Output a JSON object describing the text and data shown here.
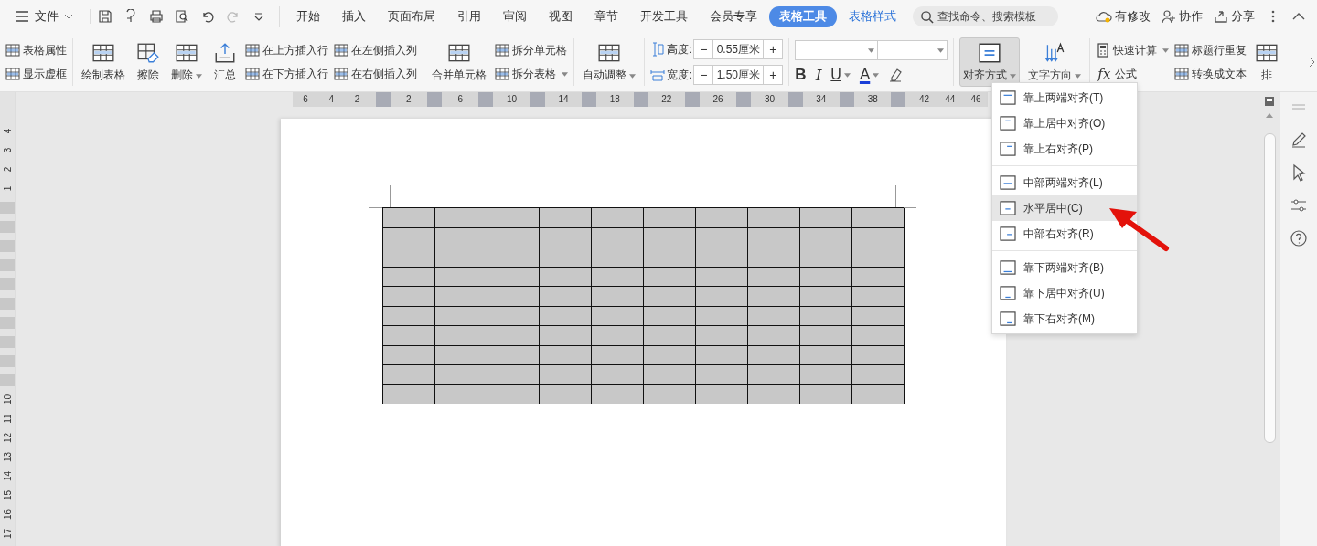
{
  "menu": {
    "label": "文件"
  },
  "tabs": [
    {
      "label": "开始",
      "selected": false,
      "kind": "normal"
    },
    {
      "label": "插入",
      "selected": false,
      "kind": "normal"
    },
    {
      "label": "页面布局",
      "selected": false,
      "kind": "normal"
    },
    {
      "label": "引用",
      "selected": false,
      "kind": "normal"
    },
    {
      "label": "审阅",
      "selected": false,
      "kind": "normal"
    },
    {
      "label": "视图",
      "selected": false,
      "kind": "normal"
    },
    {
      "label": "章节",
      "selected": false,
      "kind": "normal"
    },
    {
      "label": "开发工具",
      "selected": false,
      "kind": "normal"
    },
    {
      "label": "会员专享",
      "selected": false,
      "kind": "normal"
    },
    {
      "label": "表格工具",
      "selected": true,
      "kind": "contextual"
    },
    {
      "label": "表格样式",
      "selected": false,
      "kind": "contextual"
    }
  ],
  "search": {
    "placeholder": "查找命令、搜索模板"
  },
  "header_actions": [
    {
      "label": "有修改"
    },
    {
      "label": "协作"
    },
    {
      "label": "分享"
    }
  ],
  "ribbon": [
    {
      "columns": [
        {
          "kind": "pair",
          "items": [
            {
              "label": "表格属性",
              "dropdown": false,
              "pressed": false
            },
            {
              "label": "显示虚框",
              "dropdown": false,
              "pressed": false
            }
          ]
        }
      ]
    },
    {
      "columns": [
        {
          "kind": "large",
          "items": [
            {
              "label": "绘制表格",
              "dropdown": false,
              "pressed": false
            }
          ]
        },
        {
          "kind": "large",
          "items": [
            {
              "label": "擦除",
              "dropdown": false,
              "pressed": false
            }
          ]
        },
        {
          "kind": "large",
          "items": [
            {
              "label": "删除",
              "dropdown": true,
              "pressed": false
            }
          ]
        },
        {
          "kind": "large",
          "items": [
            {
              "label": "汇总",
              "dropdown": false,
              "pressed": false
            }
          ]
        },
        {
          "kind": "pair",
          "items": [
            {
              "label": "在上方插入行",
              "dropdown": false,
              "pressed": false
            },
            {
              "label": "在下方插入行",
              "dropdown": false,
              "pressed": false
            }
          ]
        },
        {
          "kind": "pair",
          "items": [
            {
              "label": "在左侧插入列",
              "dropdown": false,
              "pressed": false
            },
            {
              "label": "在右侧插入列",
              "dropdown": false,
              "pressed": false
            }
          ]
        }
      ]
    },
    {
      "columns": [
        {
          "kind": "large",
          "items": [
            {
              "label": "合并单元格",
              "dropdown": false,
              "pressed": false
            }
          ]
        },
        {
          "kind": "pair",
          "items": [
            {
              "label": "拆分单元格",
              "dropdown": false,
              "pressed": false
            },
            {
              "label": "拆分表格",
              "dropdown": true,
              "pressed": false
            }
          ]
        }
      ]
    },
    {
      "columns": [
        {
          "kind": "large",
          "items": [
            {
              "label": "自动调整",
              "dropdown": true,
              "pressed": false
            }
          ]
        }
      ]
    },
    {
      "columns": [
        {
          "kind": "stepper",
          "items": [
            {
              "label": "高度:",
              "value": "0.55厘米",
              "minus": "−",
              "plus": "+"
            },
            {
              "label": "宽度:",
              "value": "1.50厘米",
              "minus": "−",
              "plus": "+"
            }
          ]
        }
      ]
    },
    {
      "columns": [
        {
          "kind": "font",
          "items": [
            {
              "label": "B",
              "dropdown": false
            },
            {
              "label": "I",
              "dropdown": false
            },
            {
              "label": "U",
              "dropdown": true
            },
            {
              "label": "A",
              "dropdown": true
            }
          ]
        }
      ]
    },
    {
      "columns": [
        {
          "kind": "large",
          "items": [
            {
              "label": "对齐方式",
              "dropdown": true,
              "pressed": true
            }
          ]
        },
        {
          "kind": "large",
          "items": [
            {
              "label": "文字方向",
              "dropdown": true,
              "pressed": false
            }
          ]
        }
      ]
    },
    {
      "columns": [
        {
          "kind": "pair",
          "items": [
            {
              "label": "快速计算",
              "dropdown": true,
              "pressed": false
            },
            {
              "label": "公式",
              "symbol": "fx",
              "dropdown": false,
              "pressed": false
            }
          ]
        },
        {
          "kind": "pair",
          "items": [
            {
              "label": "标题行重复",
              "dropdown": false,
              "pressed": false
            },
            {
              "label": "转换成文本",
              "dropdown": false,
              "pressed": false
            }
          ]
        },
        {
          "kind": "large",
          "items": [
            {
              "label": "排",
              "dropdown": false,
              "pressed": false
            }
          ]
        }
      ]
    }
  ],
  "ruler": [
    {
      "kind": "number",
      "label": "6"
    },
    {
      "kind": "number",
      "label": "4"
    },
    {
      "kind": "number",
      "label": "2"
    },
    {
      "kind": "marker"
    },
    {
      "kind": "number",
      "label": "2"
    },
    {
      "kind": "marker"
    },
    {
      "kind": "number",
      "label": "6"
    },
    {
      "kind": "marker"
    },
    {
      "kind": "number",
      "label": "10"
    },
    {
      "kind": "marker"
    },
    {
      "kind": "number",
      "label": "14"
    },
    {
      "kind": "marker"
    },
    {
      "kind": "number",
      "label": "18"
    },
    {
      "kind": "marker"
    },
    {
      "kind": "number",
      "label": "22"
    },
    {
      "kind": "marker"
    },
    {
      "kind": "number",
      "label": "26"
    },
    {
      "kind": "marker"
    },
    {
      "kind": "number",
      "label": "30"
    },
    {
      "kind": "marker"
    },
    {
      "kind": "number",
      "label": "34"
    },
    {
      "kind": "marker"
    },
    {
      "kind": "number",
      "label": "38"
    },
    {
      "kind": "marker"
    },
    {
      "kind": "number",
      "label": "42"
    },
    {
      "kind": "number",
      "label": "44"
    },
    {
      "kind": "number",
      "label": "46"
    }
  ],
  "vruler": [
    {
      "kind": "number",
      "label": "4"
    },
    {
      "kind": "number",
      "label": "3"
    },
    {
      "kind": "number",
      "label": "2"
    },
    {
      "kind": "number",
      "label": "1"
    },
    {
      "kind": "marker"
    },
    {
      "kind": "marker"
    },
    {
      "kind": "marker"
    },
    {
      "kind": "marker"
    },
    {
      "kind": "marker"
    },
    {
      "kind": "marker"
    },
    {
      "kind": "marker"
    },
    {
      "kind": "marker"
    },
    {
      "kind": "marker"
    },
    {
      "kind": "marker"
    },
    {
      "kind": "number",
      "label": "10"
    },
    {
      "kind": "number",
      "label": "11"
    },
    {
      "kind": "number",
      "label": "12"
    },
    {
      "kind": "number",
      "label": "13"
    },
    {
      "kind": "number",
      "label": "14"
    },
    {
      "kind": "number",
      "label": "15"
    },
    {
      "kind": "number",
      "label": "16"
    },
    {
      "kind": "number",
      "label": "17"
    }
  ],
  "table": {
    "rows": [
      {
        "cells": [
          {
            "selected": true
          },
          {
            "selected": true
          },
          {
            "selected": true
          },
          {
            "selected": true
          },
          {
            "selected": true
          },
          {
            "selected": true
          },
          {
            "selected": true
          },
          {
            "selected": true
          },
          {
            "selected": true
          },
          {
            "selected": true
          }
        ]
      },
      {
        "cells": [
          {
            "selected": true
          },
          {
            "selected": true
          },
          {
            "selected": true
          },
          {
            "selected": true
          },
          {
            "selected": true
          },
          {
            "selected": true
          },
          {
            "selected": true
          },
          {
            "selected": true
          },
          {
            "selected": true
          },
          {
            "selected": true
          }
        ]
      },
      {
        "cells": [
          {
            "selected": true
          },
          {
            "selected": true
          },
          {
            "selected": true
          },
          {
            "selected": true
          },
          {
            "selected": true
          },
          {
            "selected": true
          },
          {
            "selected": true
          },
          {
            "selected": true
          },
          {
            "selected": true
          },
          {
            "selected": true
          }
        ]
      },
      {
        "cells": [
          {
            "selected": true
          },
          {
            "selected": true
          },
          {
            "selected": true
          },
          {
            "selected": true
          },
          {
            "selected": true
          },
          {
            "selected": true
          },
          {
            "selected": true
          },
          {
            "selected": true
          },
          {
            "selected": true
          },
          {
            "selected": true
          }
        ]
      },
      {
        "cells": [
          {
            "selected": true
          },
          {
            "selected": true
          },
          {
            "selected": true
          },
          {
            "selected": true
          },
          {
            "selected": true
          },
          {
            "selected": true
          },
          {
            "selected": true
          },
          {
            "selected": true
          },
          {
            "selected": true
          },
          {
            "selected": true
          }
        ]
      },
      {
        "cells": [
          {
            "selected": true
          },
          {
            "selected": true
          },
          {
            "selected": true
          },
          {
            "selected": true
          },
          {
            "selected": true
          },
          {
            "selected": true
          },
          {
            "selected": true
          },
          {
            "selected": true
          },
          {
            "selected": true
          },
          {
            "selected": true
          }
        ]
      },
      {
        "cells": [
          {
            "selected": true
          },
          {
            "selected": true
          },
          {
            "selected": true
          },
          {
            "selected": true
          },
          {
            "selected": true
          },
          {
            "selected": true
          },
          {
            "selected": true
          },
          {
            "selected": true
          },
          {
            "selected": true
          },
          {
            "selected": true
          }
        ]
      },
      {
        "cells": [
          {
            "selected": true
          },
          {
            "selected": true
          },
          {
            "selected": true
          },
          {
            "selected": true
          },
          {
            "selected": true
          },
          {
            "selected": true
          },
          {
            "selected": true
          },
          {
            "selected": true
          },
          {
            "selected": true
          },
          {
            "selected": true
          }
        ]
      },
      {
        "cells": [
          {
            "selected": true
          },
          {
            "selected": true
          },
          {
            "selected": true
          },
          {
            "selected": true
          },
          {
            "selected": true
          },
          {
            "selected": true
          },
          {
            "selected": true
          },
          {
            "selected": true
          },
          {
            "selected": true
          },
          {
            "selected": true
          }
        ]
      },
      {
        "cells": [
          {
            "selected": true
          },
          {
            "selected": true
          },
          {
            "selected": true
          },
          {
            "selected": true
          },
          {
            "selected": true
          },
          {
            "selected": true
          },
          {
            "selected": true
          },
          {
            "selected": true
          },
          {
            "selected": true
          },
          {
            "selected": true
          }
        ]
      }
    ]
  },
  "align_menu": {
    "groups": [
      [
        {
          "label": "靠上两端对齐(T)",
          "selected": false
        },
        {
          "label": "靠上居中对齐(O)",
          "selected": false
        },
        {
          "label": "靠上右对齐(P)",
          "selected": false
        }
      ],
      [
        {
          "label": "中部两端对齐(L)",
          "selected": false
        },
        {
          "label": "水平居中(C)",
          "selected": true
        },
        {
          "label": "中部右对齐(R)",
          "selected": false
        }
      ],
      [
        {
          "label": "靠下两端对齐(B)",
          "selected": false
        },
        {
          "label": "靠下居中对齐(U)",
          "selected": false
        },
        {
          "label": "靠下右对齐(M)",
          "selected": false
        }
      ]
    ]
  }
}
